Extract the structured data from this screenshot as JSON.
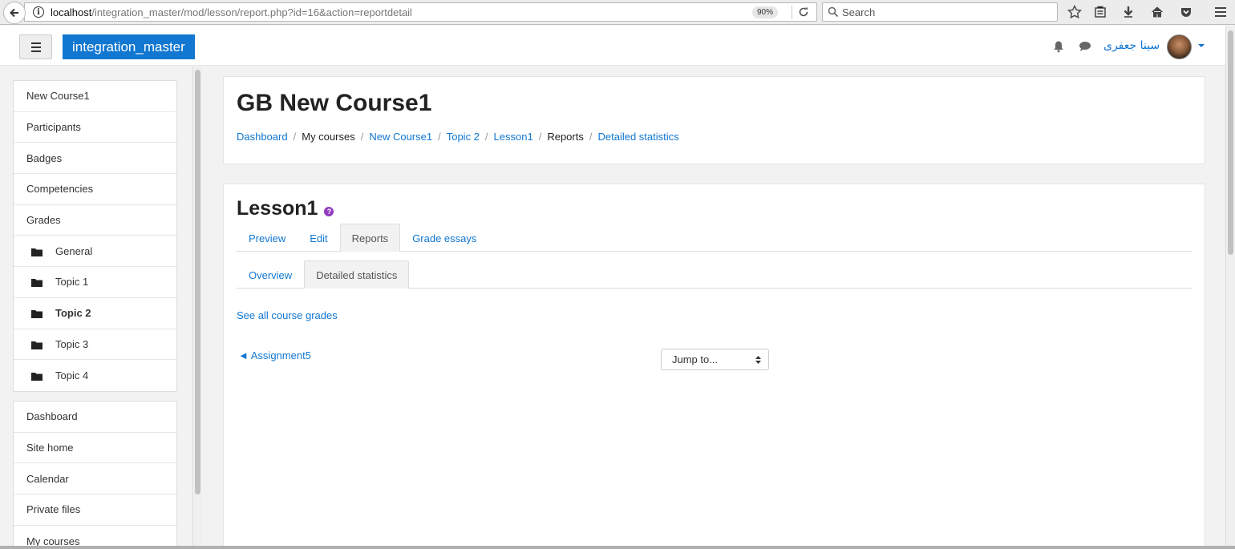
{
  "browser": {
    "url_host": "localhost",
    "url_path": "/integration_master/mod/lesson/report.php?id=16&action=reportdetail",
    "zoom": "90%",
    "search_placeholder": "Search"
  },
  "navbar": {
    "site_name": "integration_master",
    "user_name": "سینا جعفری",
    "accent": "#1177d1"
  },
  "drawer": {
    "course_items": [
      {
        "label": "New Course1",
        "icon": null
      },
      {
        "label": "Participants",
        "icon": null
      },
      {
        "label": "Badges",
        "icon": null
      },
      {
        "label": "Competencies",
        "icon": null
      },
      {
        "label": "Grades",
        "icon": null
      },
      {
        "label": "General",
        "icon": "folder-icon"
      },
      {
        "label": "Topic 1",
        "icon": "folder-icon"
      },
      {
        "label": "Topic 2",
        "icon": "folder-icon",
        "active": true
      },
      {
        "label": "Topic 3",
        "icon": "folder-icon"
      },
      {
        "label": "Topic 4",
        "icon": "folder-icon"
      }
    ],
    "site_items": [
      {
        "label": "Dashboard"
      },
      {
        "label": "Site home"
      },
      {
        "label": "Calendar"
      },
      {
        "label": "Private files"
      },
      {
        "label": "My courses"
      }
    ]
  },
  "header": {
    "title": "GB New Course1",
    "breadcrumb": [
      {
        "label": "Dashboard",
        "link": true
      },
      {
        "label": "My courses",
        "link": false
      },
      {
        "label": "New Course1",
        "link": true
      },
      {
        "label": "Topic 2",
        "link": true
      },
      {
        "label": "Lesson1",
        "link": true
      },
      {
        "label": "Reports",
        "link": false
      },
      {
        "label": "Detailed statistics",
        "link": true
      }
    ]
  },
  "main": {
    "lesson_title": "Lesson1",
    "help_glyph": "?",
    "tabs": [
      {
        "label": "Preview",
        "active": false
      },
      {
        "label": "Edit",
        "active": false
      },
      {
        "label": "Reports",
        "active": true
      },
      {
        "label": "Grade essays",
        "active": false
      }
    ],
    "subtabs": [
      {
        "label": "Overview",
        "active": false
      },
      {
        "label": "Detailed statistics",
        "active": true
      }
    ],
    "see_all_grades": "See all course grades",
    "prev_activity": "◄ Assignment5",
    "jump_to": "Jump to..."
  }
}
